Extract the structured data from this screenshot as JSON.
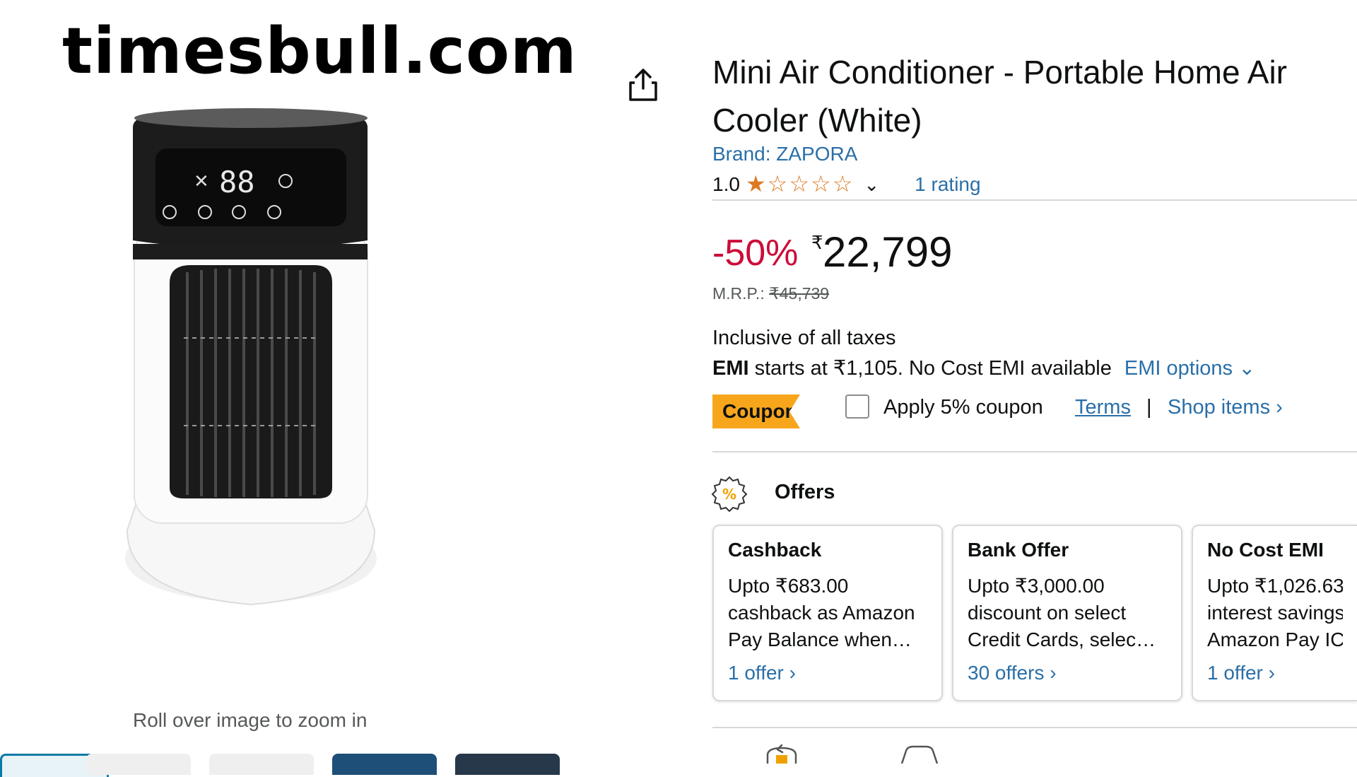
{
  "watermark": "timesbull.com",
  "product": {
    "title_line1": "Mini Air Conditioner - Portable Home Air",
    "title_line2": "Cooler (White)",
    "brand": "Brand: ZAPORA",
    "rating_value": "1.0",
    "rating_stars": 1,
    "rating_max": 5,
    "rating_count": "1 rating",
    "discount": "-50%",
    "price_symbol": "₹",
    "price": "22,799",
    "mrp_label": "M.R.P.:",
    "mrp_value": "₹45,739",
    "tax_note": "Inclusive of all taxes",
    "emi_bold": "EMI",
    "emi_text": " starts at ₹1,105. No Cost EMI available",
    "emi_options": "EMI options",
    "device_display": "88"
  },
  "coupon": {
    "badge": "Coupon:",
    "text": "Apply 5% coupon",
    "terms": "Terms",
    "separator": "|",
    "shop_items": "Shop items ›"
  },
  "offers": {
    "heading": "Offers",
    "cards": [
      {
        "title": "Cashback",
        "line1": "Upto ₹683.00",
        "line2": "cashback as Amazon",
        "line3": "Pay Balance when…",
        "link": "1 offer ›"
      },
      {
        "title": "Bank Offer",
        "line1": "Upto ₹3,000.00",
        "line2": "discount on select",
        "line3": "Credit Cards, selec…",
        "link": "30 offers ›"
      },
      {
        "title": "No Cost EMI",
        "line1": "Upto ₹1,026.63",
        "line2": "interest savings",
        "line3": "Amazon Pay ICI",
        "link": "1 offer ›"
      }
    ]
  },
  "gallery": {
    "zoom_hint": "Roll over image to zoom in"
  },
  "colors": {
    "link": "#2a6fa8",
    "discount": "#cc0c39",
    "coupon_badge": "#f7a61c",
    "star": "#de7921"
  },
  "icons": {
    "share": "share-icon",
    "offers": "percent-badge-icon",
    "chevron": "chevron-down-icon"
  }
}
